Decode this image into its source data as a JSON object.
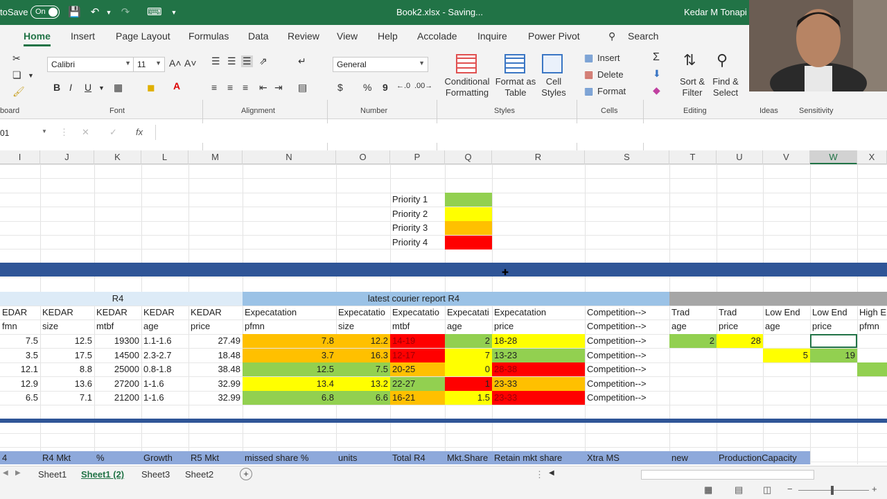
{
  "titlebar": {
    "autosave": "toSave",
    "toggle": "On",
    "doc_title": "Book2.xlsx  -  Saving...",
    "user": "Kedar M Tonapi"
  },
  "menu": {
    "tabs": [
      "Home",
      "Insert",
      "Page Layout",
      "Formulas",
      "Data",
      "Review",
      "View",
      "Help",
      "Accolade",
      "Inquire",
      "Power Pivot"
    ],
    "search": "Search"
  },
  "ribbon": {
    "font_name": "Calibri",
    "font_size": "11",
    "number_format": "General",
    "groups": {
      "clipboard": "board",
      "font": "Font",
      "alignment": "Alignment",
      "number": "Number",
      "styles": "Styles",
      "cells": "Cells",
      "editing": "Editing",
      "ideas": "Ideas",
      "sensitivity": "Sensitivity"
    },
    "styles": {
      "conditional": [
        "Conditional",
        "Formatting"
      ],
      "format_table": [
        "Format as",
        "Table"
      ],
      "cell_styles": [
        "Cell",
        "Styles"
      ]
    },
    "cells": {
      "insert": "Insert",
      "delete": "Delete",
      "format": "Format"
    },
    "editing": {
      "sort": [
        "Sort &",
        "Filter"
      ],
      "find": [
        "Find &",
        "Select"
      ]
    },
    "icons": {
      "bold": "B",
      "italic": "I",
      "underline": "U",
      "currency": "$",
      "percent": "%",
      "comma": "9"
    }
  },
  "formula_bar": {
    "name_box": "01",
    "fx": "fx",
    "content": ""
  },
  "columns": [
    {
      "l": "I"
    },
    {
      "l": "J"
    },
    {
      "l": "K"
    },
    {
      "l": "L"
    },
    {
      "l": "M"
    },
    {
      "l": "N"
    },
    {
      "l": "O"
    },
    {
      "l": "P"
    },
    {
      "l": "Q"
    },
    {
      "l": "R"
    },
    {
      "l": "S"
    },
    {
      "l": "T"
    },
    {
      "l": "U"
    },
    {
      "l": "V"
    },
    {
      "l": "W"
    },
    {
      "l": "X"
    }
  ],
  "legend": [
    {
      "label": "Priority 1",
      "color": "#92d050"
    },
    {
      "label": "Priority 2",
      "color": "#ffff00"
    },
    {
      "label": "Priority 3",
      "color": "#ffc000"
    },
    {
      "label": "Priority 4",
      "color": "#ff0000"
    }
  ],
  "headers": {
    "r4": "R4",
    "courier": "latest courier report R4",
    "row1": [
      "EDAR",
      "KEDAR",
      "KEDAR",
      "KEDAR",
      "KEDAR",
      "Expecatation",
      "Expecatatio",
      "Expecatatio",
      "Expecatati",
      "Expecatation",
      "Competition-->",
      "Trad",
      "Trad",
      "Low End",
      "Low End",
      "High E"
    ],
    "row2": [
      "fmn",
      "size",
      "mtbf",
      "age",
      "price",
      "pfmn",
      "size",
      "mtbf",
      "age",
      "price",
      "Competition-->",
      "age",
      "price",
      "age",
      "price",
      "pfmn"
    ]
  },
  "rows": [
    [
      "7.5",
      "12.5",
      "19300",
      "1.1-1.6",
      "27.49",
      "7.8",
      "12.2",
      "14-19",
      "2",
      "18-28",
      "Competition-->",
      "2",
      "28",
      "",
      "",
      ""
    ],
    [
      "3.5",
      "17.5",
      "14500",
      "2.3-2.7",
      "18.48",
      "3.7",
      "16.3",
      "12-17",
      "7",
      "13-23",
      "Competition-->",
      "",
      "",
      "5",
      "19",
      ""
    ],
    [
      "12.1",
      "8.8",
      "25000",
      "0.8-1.8",
      "38.48",
      "12.5",
      "7.5",
      "20-25",
      "0",
      "28-38",
      "Competition-->",
      "",
      "",
      "",
      "",
      ""
    ],
    [
      "12.9",
      "13.6",
      "27200",
      "1-1.6",
      "32.99",
      "13.4",
      "13.2",
      "22-27",
      "1",
      "23-33",
      "Competition-->",
      "",
      "",
      "",
      "",
      ""
    ],
    [
      "6.5",
      "7.1",
      "21200",
      "1-1.6",
      "32.99",
      "6.8",
      "6.6",
      "16-21",
      "1.5",
      "23-33",
      "Competition-->",
      "",
      "",
      "",
      "",
      ""
    ]
  ],
  "footer_row": [
    "4",
    "R4 Mkt",
    "%",
    "Growth",
    "R5 Mkt",
    "missed share %",
    "units",
    "Total R4",
    "Mkt.Share",
    "Retain mkt share",
    "Xtra MS",
    "new",
    "ProductionCapacity"
  ],
  "sheets": [
    "Sheet1",
    "Sheet1 (2)",
    "Sheet3",
    "Sheet2"
  ]
}
